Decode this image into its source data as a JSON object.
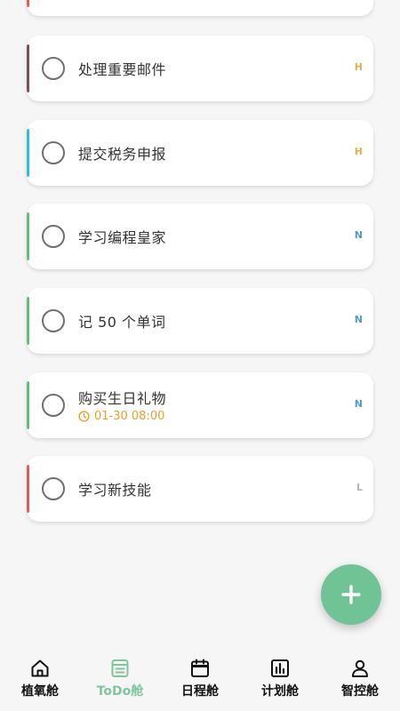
{
  "tasks": [
    {
      "title": "处理重要邮件",
      "priority": "H",
      "bar_color": "#7a4f4f",
      "prio_color": "#e0b247",
      "due": ""
    },
    {
      "title": "提交税务申报",
      "priority": "H",
      "bar_color": "#2ec0d6",
      "prio_color": "#e0b247",
      "due": ""
    },
    {
      "title": "学习编程皇家",
      "priority": "N",
      "bar_color": "#66bb76",
      "prio_color": "#4a9fce",
      "due": ""
    },
    {
      "title": "记 50 个单词",
      "priority": "N",
      "bar_color": "#66bb76",
      "prio_color": "#4a9fce",
      "due": ""
    },
    {
      "title": "购买生日礼物",
      "priority": "N",
      "bar_color": "#66bb76",
      "prio_color": "#4a9fce",
      "due": "01-30 08:00"
    },
    {
      "title": "学习新技能",
      "priority": "L",
      "bar_color": "#e05a5a",
      "prio_color": "#b5b5b5",
      "due": ""
    }
  ],
  "top_partial_bar_color": "#e05a5a",
  "fab": {
    "icon": "plus-icon",
    "color": "#6fc394"
  },
  "nav": {
    "items": [
      {
        "label": "植氧舱",
        "icon": "home-icon",
        "active": false
      },
      {
        "label": "ToDo舱",
        "icon": "todo-icon",
        "active": true
      },
      {
        "label": "日程舱",
        "icon": "calendar-icon",
        "active": false
      },
      {
        "label": "计划舱",
        "icon": "chart-icon",
        "active": false
      },
      {
        "label": "智控舱",
        "icon": "user-icon",
        "active": false
      }
    ],
    "active_color": "#7cc79b"
  }
}
